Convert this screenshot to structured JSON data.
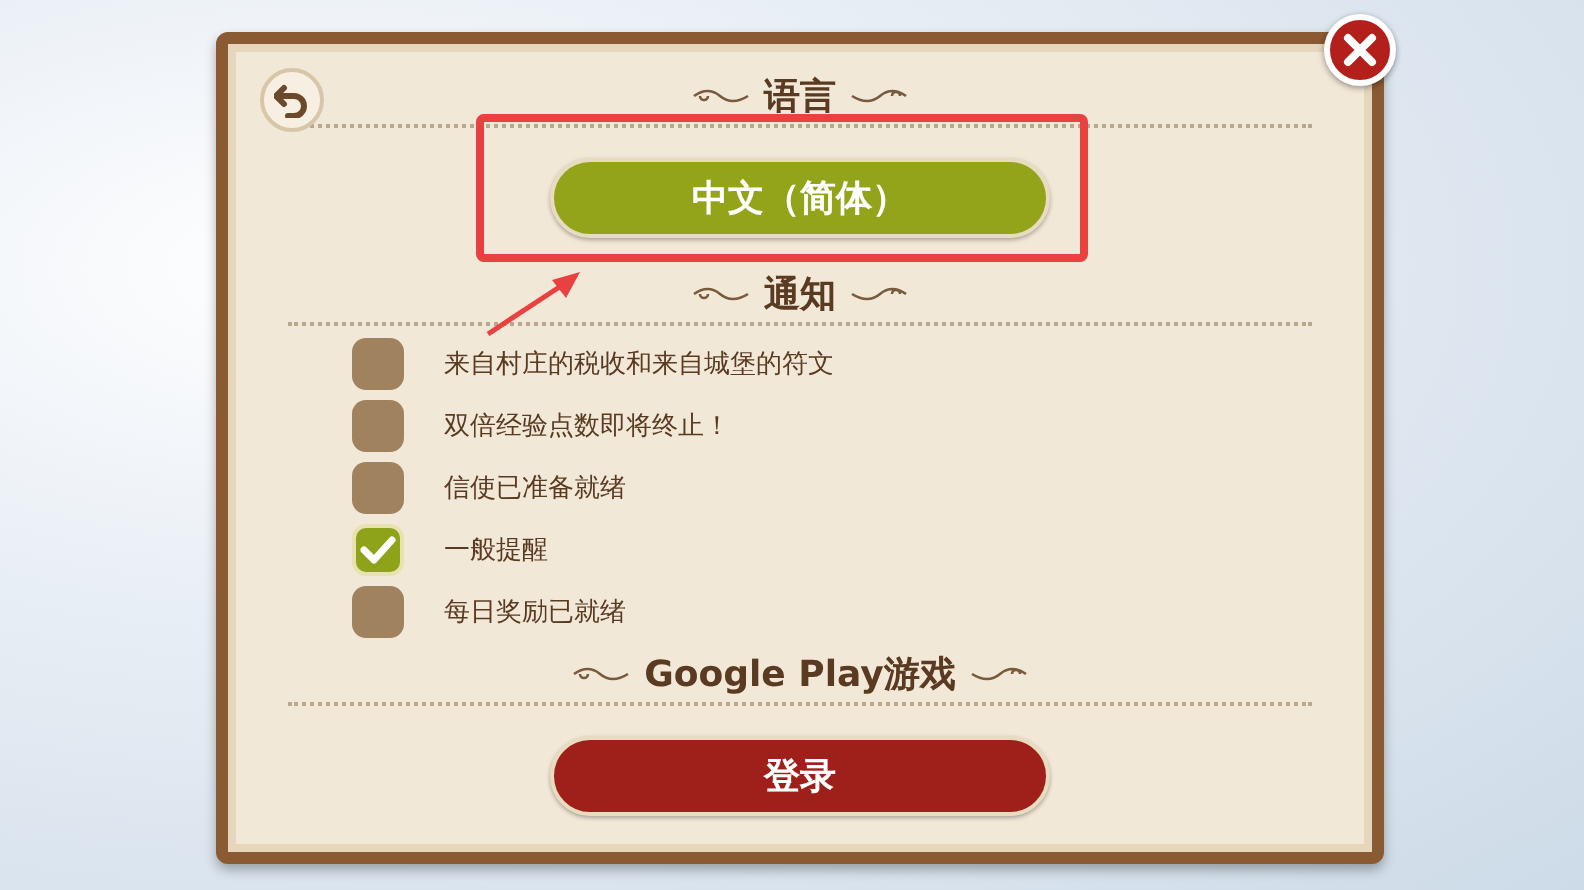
{
  "sections": [
    {
      "kind": "button",
      "heading": "语言",
      "button": {
        "label": "中文（简体）",
        "kind": "language"
      }
    },
    {
      "kind": "checklist",
      "heading": "通知",
      "items": [
        {
          "label": "来自村庄的税收和来自城堡的符文",
          "checked": false
        },
        {
          "label": "双倍经验点数即将终止！",
          "checked": false
        },
        {
          "label": "信使已准备就绪",
          "checked": false
        },
        {
          "label": "一般提醒",
          "checked": true
        },
        {
          "label": "每日奖励已就绪",
          "checked": false
        }
      ]
    },
    {
      "kind": "button",
      "heading": "Google Play游戏",
      "button": {
        "label": "登录",
        "kind": "login"
      }
    }
  ]
}
